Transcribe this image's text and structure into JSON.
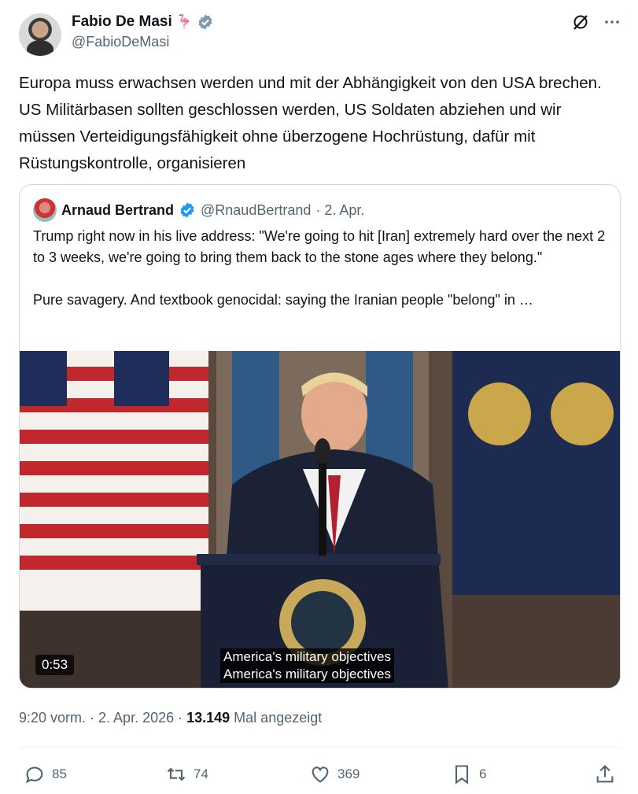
{
  "author": {
    "name": "Fabio De Masi",
    "emoji": "🦩",
    "handle": "@FabioDeMasi"
  },
  "tweet": {
    "text": "Europa muss erwachsen werden und mit der Abhängigkeit von den USA brechen. US Militärbasen sollten geschlossen werden, US Soldaten abziehen und wir müssen Verteidigungsfähigkeit ohne überzogene Hochrüstung, dafür mit Rüstungskontrolle, organisieren"
  },
  "quote": {
    "name": "Arnaud Bertrand",
    "handle": "@RnaudBertrand",
    "date": "· 2. Apr.",
    "paragraph1": "Trump right now in his live address: \"We're going to hit [Iran] extremely hard over the next 2 to 3 weeks, we're going to bring them back to the stone ages where they belong.\"",
    "paragraph2": "Pure savagery. And textbook genocidal: saying the Iranian people \"belong\" in …",
    "video": {
      "duration": "0:53",
      "caption_line1": "America's military objectives",
      "caption_line2": "America's military objectives"
    }
  },
  "meta": {
    "time": "9:20 vorm. · 2. Apr. 2026 · ",
    "views": "13.149",
    "views_label": " Mal angezeigt"
  },
  "actions": {
    "replies": "85",
    "reposts": "74",
    "likes": "369",
    "bookmarks": "6"
  },
  "colors": {
    "accent": "#1d9bf0",
    "text_secondary": "#536471",
    "border": "#cfd9de"
  },
  "icons": [
    "verified-icon",
    "grok-icon",
    "more-icon",
    "reply-icon",
    "repost-icon",
    "like-icon",
    "bookmark-icon",
    "share-icon"
  ]
}
